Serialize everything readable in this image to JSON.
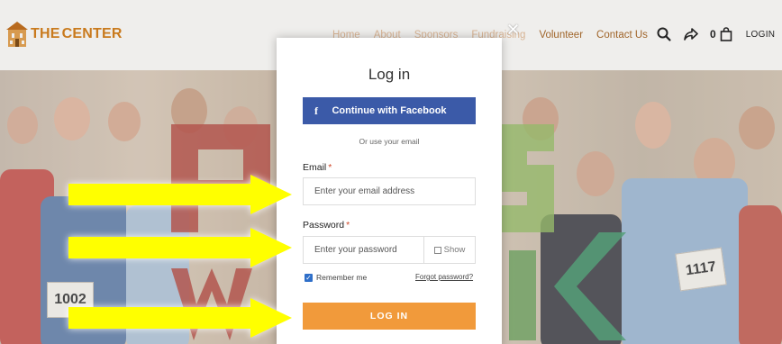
{
  "header": {
    "logo": {
      "text_left": "THE",
      "text_small": "",
      "text_right": "CENTER"
    },
    "nav": [
      {
        "label": "Home",
        "dim": true
      },
      {
        "label": "About",
        "dim": true
      },
      {
        "label": "Sponsors",
        "dim": true
      },
      {
        "label": "Fundraising",
        "dim": true
      },
      {
        "label": "Volunteer",
        "dim": false
      },
      {
        "label": "Contact Us",
        "dim": false
      }
    ],
    "cart_count": "0",
    "login_label": "LOGIN",
    "icons": [
      "search-icon",
      "share-icon",
      "cart-icon"
    ]
  },
  "hero": {
    "bibs": [
      "1002",
      "1117"
    ]
  },
  "modal": {
    "close": "✕",
    "title": "Log in",
    "facebook_button": "Continue with Facebook",
    "facebook_glyph": "f",
    "or_text": "Or use your email",
    "email_label": "Email",
    "email_placeholder": "Enter your email address",
    "email_value": "",
    "password_label": "Password",
    "password_placeholder": "Enter your password",
    "password_value": "",
    "required_mark": "*",
    "show_label": "Show",
    "remember_label": "Remember me",
    "remember_checked": true,
    "forgot_label": "Forgot password?",
    "login_button": "LOG IN"
  },
  "colors": {
    "facebook_blue": "#3b5aa8",
    "login_orange": "#f19a3b",
    "logo_orange": "#c97a1d",
    "arrow_yellow": "#ffff00",
    "required_red": "#d04a2b"
  },
  "annotations": {
    "arrows": 3,
    "color": "yellow"
  }
}
